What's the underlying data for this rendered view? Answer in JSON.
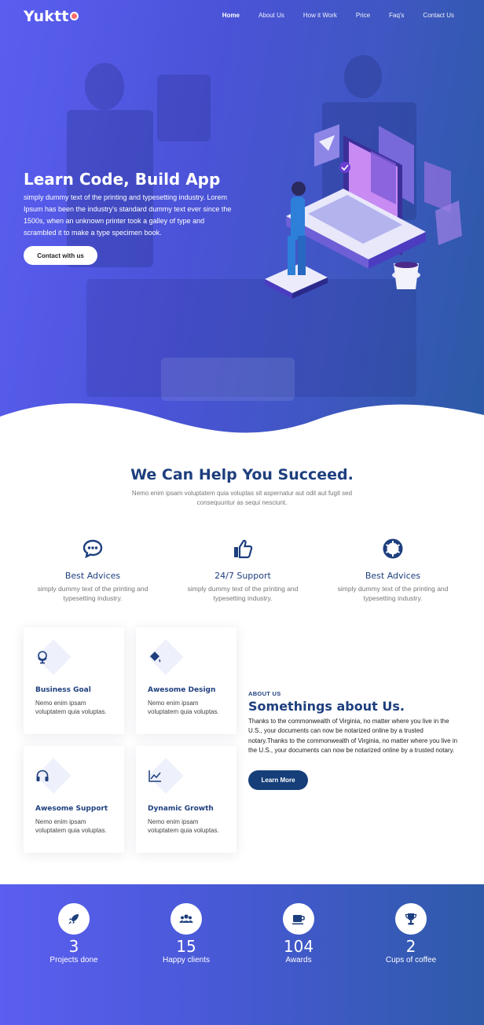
{
  "brand": {
    "name": "Yuktt"
  },
  "nav": [
    {
      "label": "Home",
      "active": true
    },
    {
      "label": "About Us",
      "active": false
    },
    {
      "label": "How it Work",
      "active": false
    },
    {
      "label": "Price",
      "active": false
    },
    {
      "label": "Faq's",
      "active": false
    },
    {
      "label": "Contact Us",
      "active": false
    }
  ],
  "hero": {
    "title": "Learn Code, Build App",
    "text": "simply dummy text of the printing and typesetting industry. Lorem Ipsum has been the industry's standard dummy text ever since the 1500s, when an unknown printer took a galley of type and scrambled it to make a type specimen book.",
    "cta": "Contact with us"
  },
  "help": {
    "title": "We Can Help You Succeed.",
    "subtitle": "Nemo enim ipsam voluptatem quia voluptas sit aspernatur aut odit aut fugit sed consequuntur as sequi nesciunt.",
    "features": [
      {
        "icon": "chat-bubble-icon",
        "title": "Best Advices",
        "text": "simply dummy text of the printing and typesetting industry."
      },
      {
        "icon": "thumbs-up-icon",
        "title": "24/7 Support",
        "text": "simply dummy text of the printing and typesetting industry."
      },
      {
        "icon": "aperture-icon",
        "title": "Best Advices",
        "text": "simply dummy text of the printing and typesetting industry."
      }
    ]
  },
  "cards": [
    {
      "icon": "globe-icon",
      "title": "Business Goal",
      "text": "Nemo enim ipsam voluptatem quia voluptas."
    },
    {
      "icon": "paint-bucket-icon",
      "title": "Awesome Design",
      "text": "Nemo enim ipsam voluptatem quia voluptas."
    },
    {
      "icon": "headphones-icon",
      "title": "Awesome Support",
      "text": "Nemo enim ipsam voluptatem quia voluptas."
    },
    {
      "icon": "line-chart-icon",
      "title": "Dynamic Growth",
      "text": "Nemo enim ipsam voluptatem quia voluptas."
    }
  ],
  "about": {
    "label": "ABOUT US",
    "title": "Somethings about Us.",
    "text": "Thanks to the commonwealth of Virginia, no matter where you live in the U.S., your documents can now be notarized online by a trusted notary.Thanks to the commonwealth of Virginia, no matter where you live in the U.S., your documents can now be notarized online by a trusted notary.",
    "button": "Learn More"
  },
  "stats": [
    {
      "icon": "rocket-icon",
      "value": "3",
      "label": "Projects done"
    },
    {
      "icon": "users-icon",
      "value": "15",
      "label": "Happy clients"
    },
    {
      "icon": "coffee-cup-icon",
      "value": "104",
      "label": "Awards"
    },
    {
      "icon": "trophy-icon",
      "value": "2",
      "label": "Cups of coffee"
    }
  ],
  "colors": {
    "primary": "#1e3f7e",
    "hero_gradient_start": "#5a5ef0",
    "hero_gradient_end": "#2b5aa5",
    "button_dark": "#163f7a",
    "logo_accent": "#ff6b6b"
  }
}
